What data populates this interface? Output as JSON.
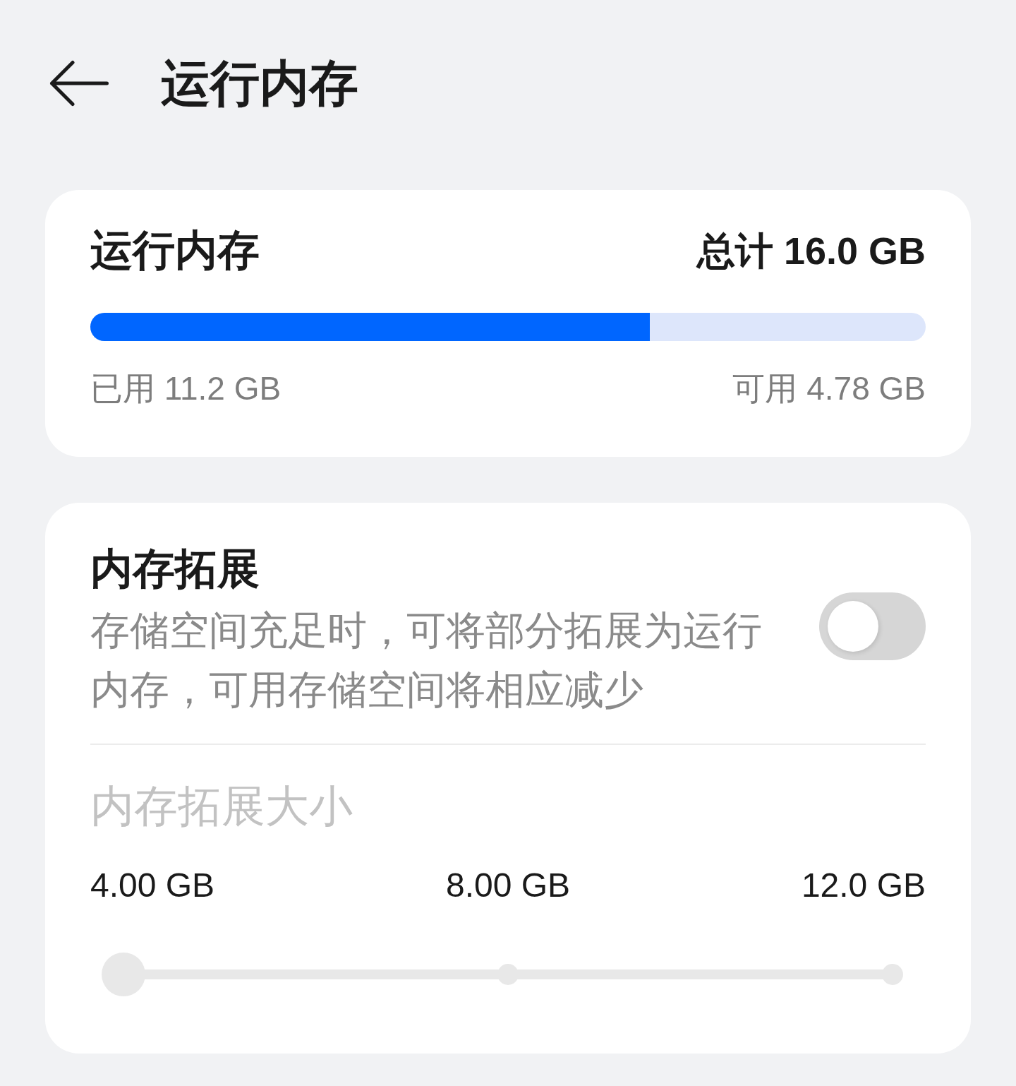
{
  "header": {
    "title": "运行内存"
  },
  "memory_card": {
    "title": "运行内存",
    "total": "总计 16.0 GB",
    "usage": {
      "level": 0.67
    },
    "used": "已用 11.2 GB",
    "available": "可用 4.78 GB"
  },
  "expansion_card": {
    "title": "内存拓展",
    "description": "存储空间充足时，可将部分拓展为运行内存，可用存储空间将相应减少",
    "toggle": {
      "on": false
    },
    "size": {
      "title": "内存拓展大小",
      "disabled": true,
      "options": [
        "4.00 GB",
        "8.00 GB",
        "12.0 GB"
      ],
      "slider": {
        "level": 0
      }
    }
  }
}
